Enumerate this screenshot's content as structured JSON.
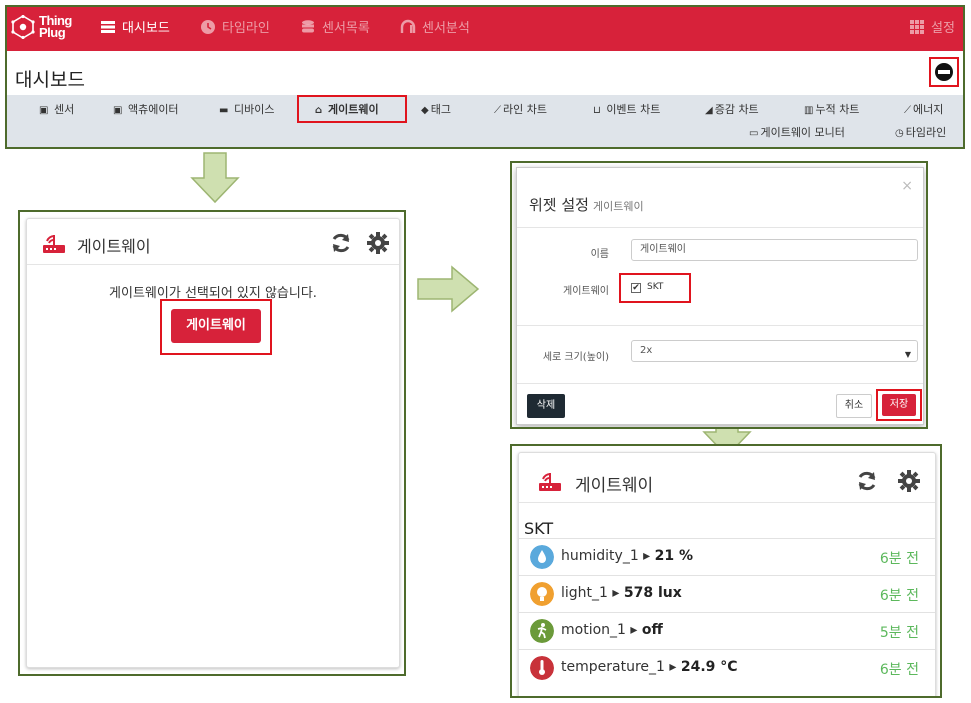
{
  "colors": {
    "brand_red": "#d7223a",
    "highlight_red": "#e0141e",
    "frame_green": "#4e6b2c",
    "arrow_green": "#cfe0b0",
    "time_green": "#5cb85c"
  },
  "navbar": {
    "logo": {
      "line1": "Thing",
      "line2": "Plug"
    },
    "items": [
      {
        "label": "대시보드",
        "icon": "dashboard-icon",
        "active": true
      },
      {
        "label": "타임라인",
        "icon": "clock-icon",
        "active": false
      },
      {
        "label": "센서목록",
        "icon": "database-icon",
        "active": false
      },
      {
        "label": "센서분석",
        "icon": "analytics-icon",
        "active": false
      }
    ],
    "settings_label": "설정",
    "settings_icon": "grid-icon"
  },
  "page": {
    "title": "대시보드"
  },
  "widget_bar": {
    "items": [
      {
        "label": "센서",
        "icon": "sensor-icon"
      },
      {
        "label": "액츄에이터",
        "icon": "actuator-icon"
      },
      {
        "label": "디바이스",
        "icon": "device-icon"
      },
      {
        "label": "게이트웨이",
        "icon": "gateway-icon",
        "selected": true
      },
      {
        "label": "태그",
        "icon": "tag-icon"
      },
      {
        "label": "라인 차트",
        "icon": "line-chart-icon"
      },
      {
        "label": "이벤트 차트",
        "icon": "event-chart-icon"
      },
      {
        "label": "증감 차트",
        "icon": "area-chart-icon"
      },
      {
        "label": "누적 차트",
        "icon": "bar-chart-icon"
      },
      {
        "label": "에너지",
        "icon": "energy-icon"
      },
      {
        "label": "게이트웨이 모니터",
        "icon": "monitor-icon"
      },
      {
        "label": "타임라인",
        "icon": "clock-icon"
      }
    ]
  },
  "left_widget": {
    "title": "게이트웨이",
    "empty_message": "게이트웨이가 선택되어 있지 않습니다.",
    "select_button": "게이트웨이"
  },
  "settings_modal": {
    "title": "위젯 설정",
    "subtitle": "게이트웨이",
    "close": "×",
    "name_label": "이름",
    "name_value": "게이트웨이",
    "gateway_label": "게이트웨이",
    "gateway_option": "SKT",
    "gateway_checked": true,
    "height_label": "세로 크기(높이)",
    "height_value": "2x",
    "delete_button": "삭제",
    "cancel_button": "취소",
    "save_button": "저장"
  },
  "right_widget": {
    "title": "게이트웨이",
    "group": "SKT",
    "sensors": [
      {
        "name": "humidity_1",
        "value": "21 %",
        "time": "6분 전",
        "icon": "humidity-icon",
        "color": "#5aa9dc"
      },
      {
        "name": "light_1",
        "value": "578 lux",
        "time": "6분 전",
        "icon": "light-bulb-icon",
        "color": "#f0a030"
      },
      {
        "name": "motion_1",
        "value": "off",
        "time": "5분 전",
        "icon": "motion-icon",
        "color": "#6b9a3a"
      },
      {
        "name": "temperature_1",
        "value": "24.9 °C",
        "time": "6분 전",
        "icon": "thermometer-icon",
        "color": "#c8323a"
      }
    ]
  }
}
